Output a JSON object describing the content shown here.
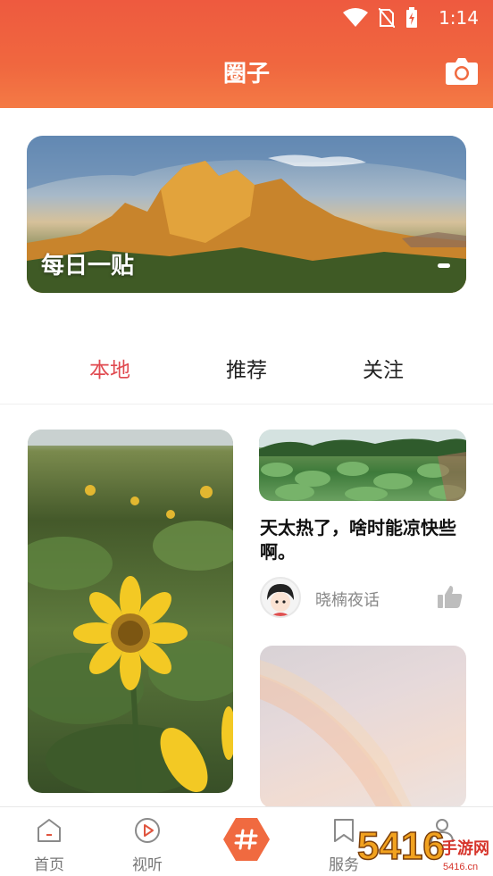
{
  "status_bar": {
    "time": "1:14",
    "icons": [
      "wifi-icon",
      "no-sim-icon",
      "battery-charging-icon"
    ]
  },
  "header": {
    "title": "圈子",
    "right_icon": "camera-icon"
  },
  "banner": {
    "label": "每日一贴"
  },
  "tabs": [
    {
      "label": "本地",
      "active": true
    },
    {
      "label": "推荐",
      "active": false
    },
    {
      "label": "关注",
      "active": false
    }
  ],
  "feed": {
    "post": {
      "title": "天太热了，啥时能凉快些啊。",
      "author": "晓楠夜话",
      "like_icon": "thumbs-up-icon"
    }
  },
  "bottom_nav": [
    {
      "label": "首页",
      "icon": "home-icon"
    },
    {
      "label": "视听",
      "icon": "play-icon"
    },
    {
      "label": "",
      "icon": "hashtag-icon"
    },
    {
      "label": "服务",
      "icon": "bookmark-icon"
    },
    {
      "label": "",
      "icon": "user-icon"
    }
  ],
  "watermark": {
    "text": "5416手游网",
    "url": "5416.cn"
  },
  "colors": {
    "header_top": "#ee5a3f",
    "header_bottom": "#f47a45",
    "tab_active": "#e04a50",
    "center_button": "#f06a40"
  }
}
